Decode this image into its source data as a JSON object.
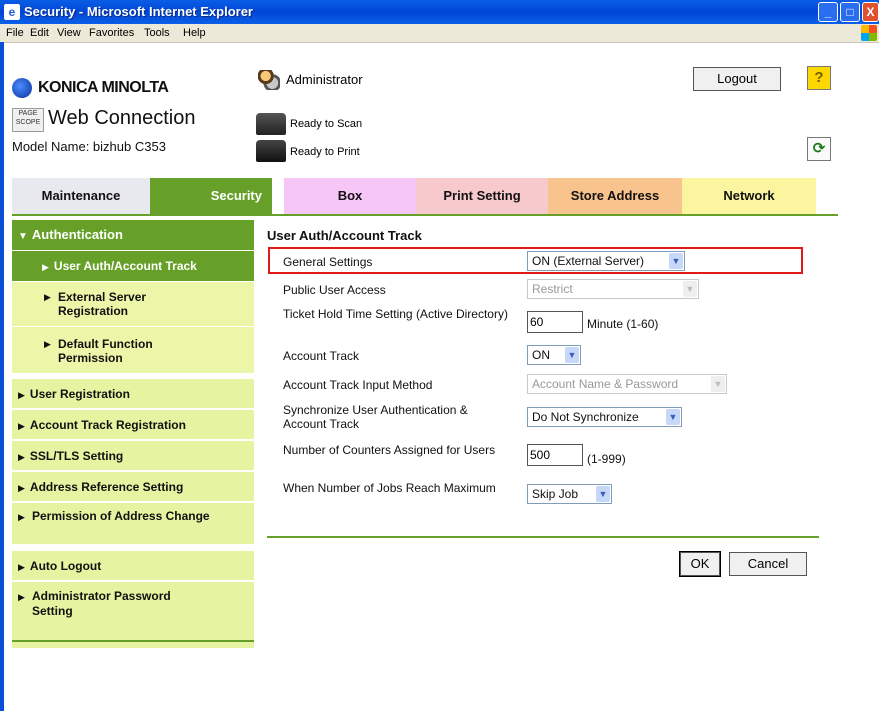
{
  "window": {
    "title": "Security - Microsoft Internet Explorer",
    "app_icon": "e",
    "min": "_",
    "max": "□",
    "close": "X"
  },
  "menu": [
    "File",
    "Edit",
    "View",
    "Favorites",
    "Tools",
    "Help"
  ],
  "header": {
    "brand": "KONICA MINOLTA",
    "pagescope": "PAGE\nSCOPE",
    "product": "Web Connection",
    "model": "Model Name: bizhub C353",
    "user": "Administrator",
    "logout": "Logout",
    "help": "?",
    "scan_status": "Ready to Scan",
    "print_status": "Ready to Print",
    "refresh": "⟳"
  },
  "tabs": {
    "maintenance": "Maintenance",
    "security": "Security",
    "box": "Box",
    "print_setting": "Print Setting",
    "store_address": "Store Address",
    "network": "Network"
  },
  "sidebar": {
    "head": "Authentication",
    "sub1": "User Auth/Account Track",
    "sub2": "External Server Registration",
    "sub3": "Default Function Permission",
    "m1": "User Registration",
    "m2": "Account Track Registration",
    "m3": "SSL/TLS Setting",
    "m4": "Address Reference Setting",
    "m5": "Permission of Address Change",
    "m6": "Auto Logout",
    "m7": "Administrator Password Setting"
  },
  "form": {
    "title": "User Auth/Account Track",
    "general_label": "General Settings",
    "general_value": "ON (External Server)",
    "public_label": "Public User Access",
    "public_value": "Restrict",
    "ticket_label": "Ticket Hold Time Setting (Active Directory)",
    "ticket_value": "60",
    "ticket_unit": "Minute (1-60)",
    "account_label": "Account Track",
    "account_value": "ON",
    "input_method_label": "Account Track Input Method",
    "input_method_value": "Account Name & Password",
    "sync_label": "Synchronize User Authentication & Account Track",
    "sync_value": "Do Not Synchronize",
    "counters_label": "Number of Counters Assigned for Users",
    "counters_value": "500",
    "counters_unit": "(1-999)",
    "jobs_label": "When Number of Jobs Reach Maximum",
    "jobs_value": "Skip Job",
    "ok": "OK",
    "cancel": "Cancel"
  },
  "colors": {
    "security_green": "#66a028",
    "highlight_red": "#e01a1a"
  }
}
